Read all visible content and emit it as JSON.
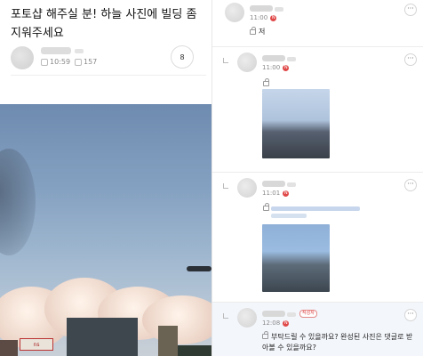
{
  "post": {
    "title": "포토샵 해주실 분! 하늘 사진에 빌딩 좀 지워주세요",
    "time": "10:59",
    "views": "157",
    "comment_count": "8"
  },
  "photo": {
    "sign_text": "ns"
  },
  "comments": [
    {
      "time": "11:00",
      "text": "저"
    },
    {
      "time": "11:00",
      "text": ""
    },
    {
      "time": "11:01",
      "text": ""
    },
    {
      "time": "12:08",
      "badge": "작성자",
      "text": "부탁드릴 수 있을까요? 완성된 사진은 댓글로 받아볼 수 있을까요?"
    }
  ],
  "ui": {
    "more": "···",
    "new_marker": "N"
  }
}
